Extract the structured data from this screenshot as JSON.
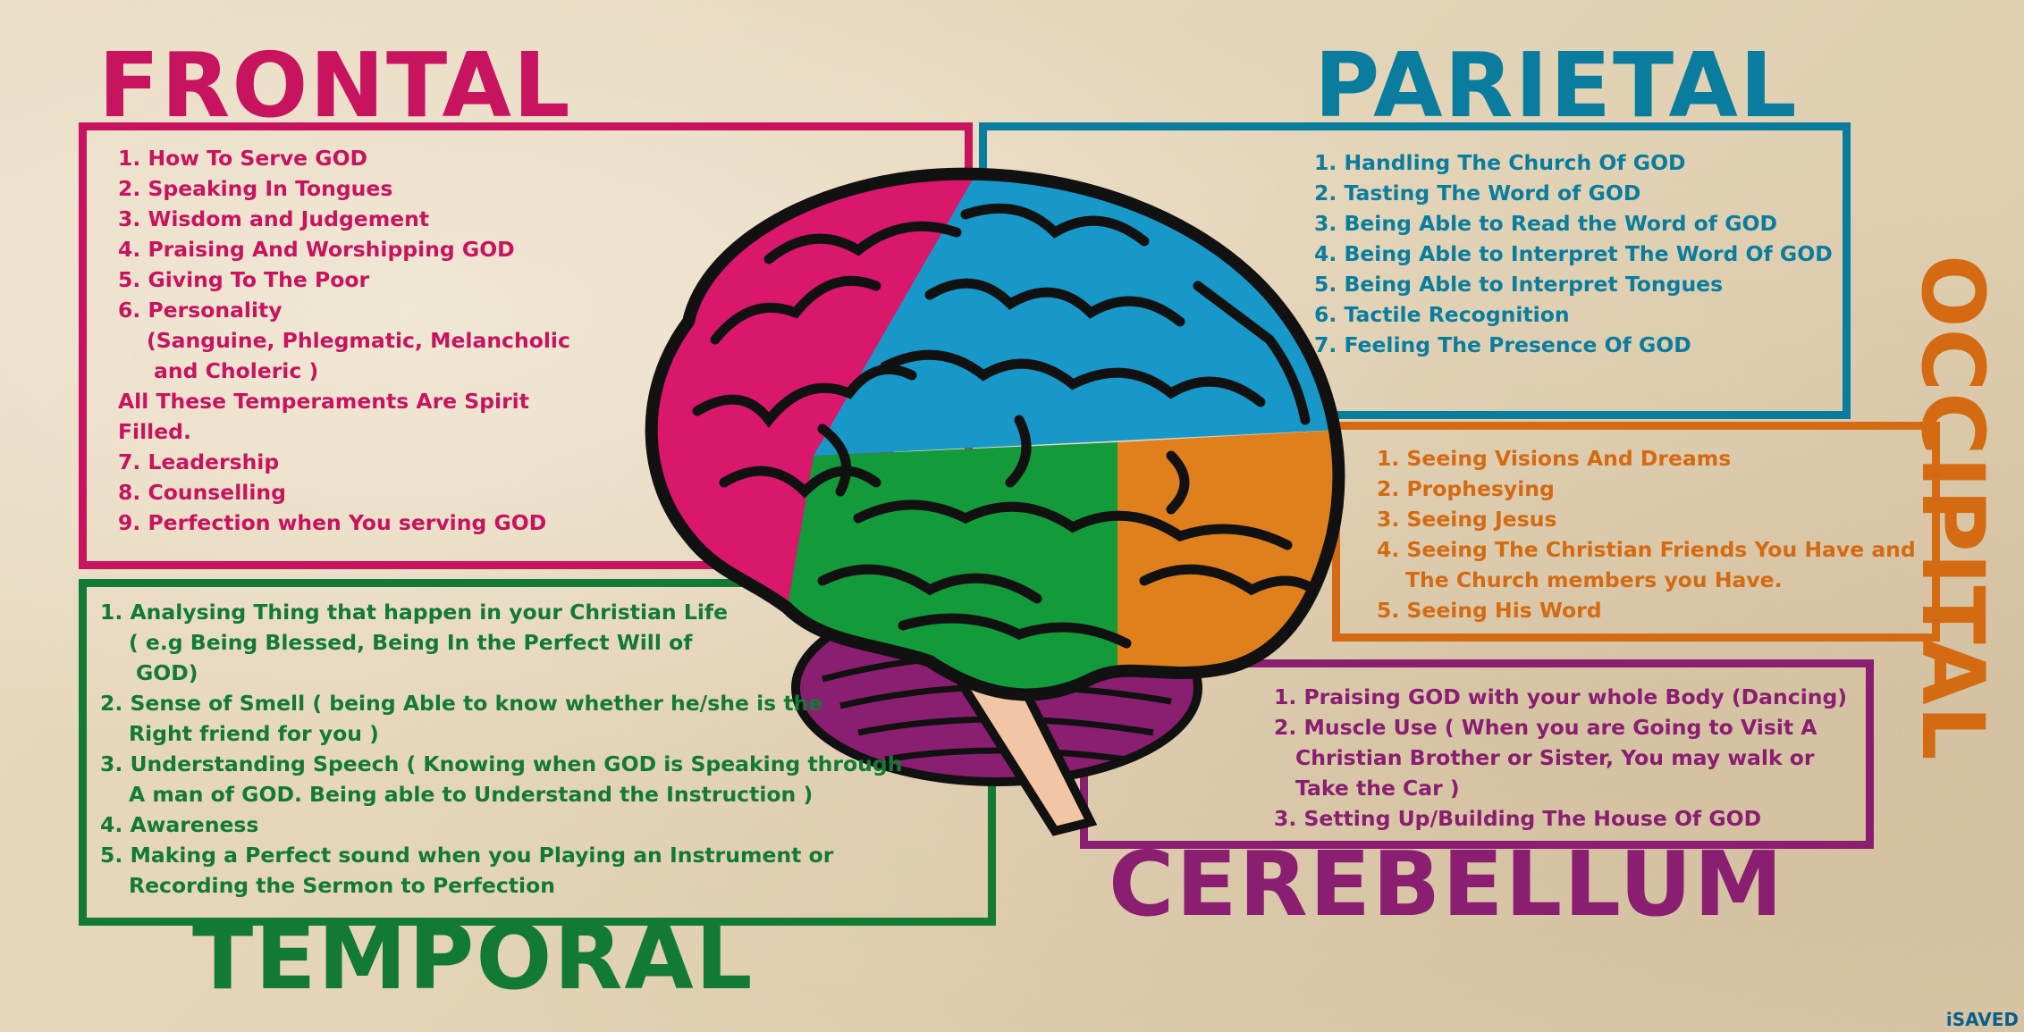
{
  "titles": {
    "frontal": "FRONTAL",
    "parietal": "PARIETAL",
    "occipital": "OCCIPITAL",
    "temporal": "TEMPORAL",
    "cerebellum": "CEREBELLUM"
  },
  "colors": {
    "frontal": "#c8135f",
    "parietal": "#0a7d9e",
    "occipital": "#d46b12",
    "temporal": "#127a35",
    "cerebellum": "#8a1e70"
  },
  "frontal": {
    "lines": [
      "1. How To Serve GOD",
      "2. Speaking In Tongues",
      "3. Wisdom and Judgement",
      "4. Praising And Worshipping GOD",
      "5. Giving To The Poor",
      "6. Personality",
      "(Sanguine, Phlegmatic, Melancholic",
      "and Choleric )",
      "All These Temperaments Are Spirit",
      "Filled.",
      "7. Leadership",
      "8. Counselling",
      "9. Perfection when You serving GOD"
    ]
  },
  "parietal": {
    "lines": [
      "1. Handling The Church Of GOD",
      "2. Tasting The Word of GOD",
      "3. Being Able to Read the Word of GOD",
      "4. Being Able to Interpret The Word Of GOD",
      "5. Being Able to Interpret Tongues",
      "6. Tactile Recognition",
      "7. Feeling The Presence Of GOD"
    ]
  },
  "occipital": {
    "lines": [
      "1. Seeing Visions And Dreams",
      "2. Prophesying",
      "3. Seeing Jesus",
      "4. Seeing The Christian Friends You Have and",
      "The Church members you Have.",
      "5. Seeing His Word"
    ]
  },
  "temporal": {
    "lines": [
      "1. Analysing Thing that happen in your Christian Life",
      "( e.g Being Blessed, Being In the Perfect Will of",
      "GOD)",
      "2. Sense of Smell ( being Able to know whether he/she is the",
      "Right friend for you )",
      "3. Understanding Speech ( Knowing when GOD is Speaking through",
      "A man of GOD. Being able to Understand the Instruction )",
      "4. Awareness",
      "5. Making a Perfect sound when you Playing an Instrument or",
      "Recording the Sermon to Perfection"
    ]
  },
  "cerebellum": {
    "lines": [
      "1. Praising GOD with your whole Body (Dancing)",
      "2. Muscle Use ( When you are Going to Visit A",
      "Christian Brother or Sister, You may walk or",
      "Take the Car )",
      "3. Setting Up/Building The House Of GOD"
    ]
  },
  "watermark": "iSAVED"
}
